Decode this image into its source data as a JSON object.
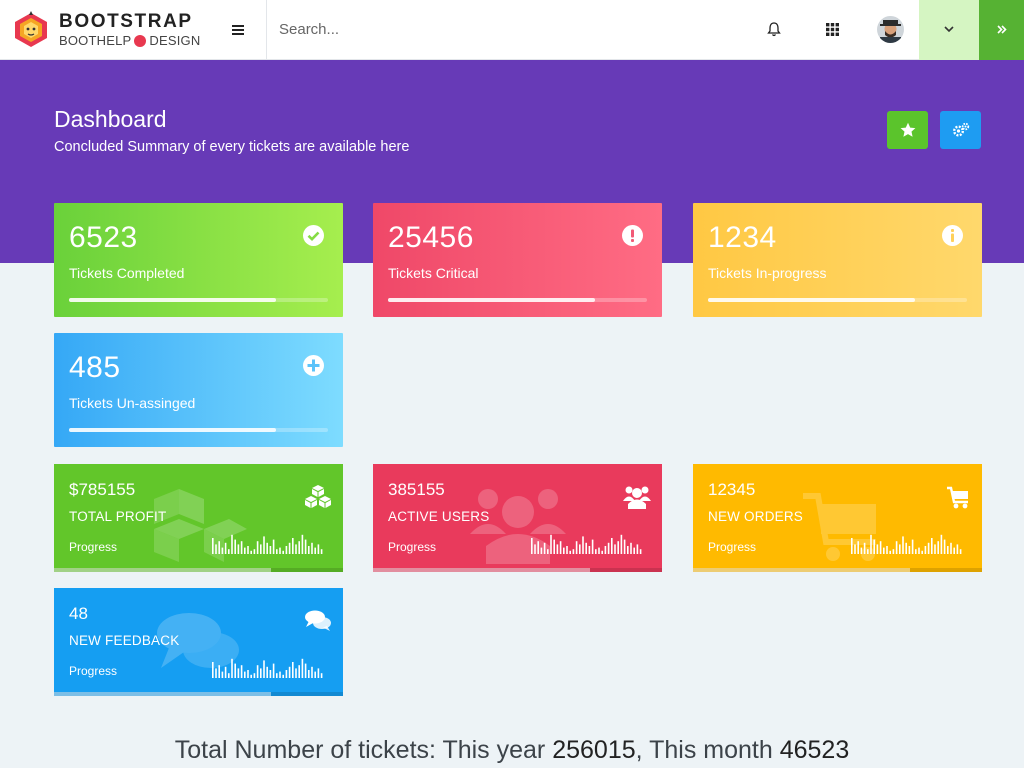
{
  "brand": {
    "title": "BOOTSTRAP",
    "sub_left": "BOOTHELP",
    "sub_right": "DESIGN"
  },
  "topbar": {
    "search_placeholder": "Search..."
  },
  "header": {
    "title": "Dashboard",
    "subtitle": "Concluded Summary of every tickets are available here"
  },
  "stats": [
    {
      "value": "6523",
      "label": "Tickets Completed",
      "progress": 0.8,
      "icon": "check-circle-icon"
    },
    {
      "value": "25456",
      "label": "Tickets Critical",
      "progress": 0.8,
      "icon": "exclamation-circle-icon"
    },
    {
      "value": "1234",
      "label": "Tickets In-progress",
      "progress": 0.8,
      "icon": "info-circle-icon"
    },
    {
      "value": "485",
      "label": "Tickets Un-assinged",
      "progress": 0.8,
      "icon": "plus-circle-icon"
    }
  ],
  "info_cards": [
    {
      "value": "$785155",
      "title": "TOTAL PROFIT",
      "progress_label": "Progress",
      "progress": 0.75,
      "icon": "cubes-icon"
    },
    {
      "value": "385155",
      "title": "ACTIVE USERS",
      "progress_label": "Progress",
      "progress": 0.75,
      "icon": "users-icon"
    },
    {
      "value": "12345",
      "title": "NEW ORDERS",
      "progress_label": "Progress",
      "progress": 0.75,
      "icon": "cart-icon"
    },
    {
      "value": "48",
      "title": "NEW FEEDBACK",
      "progress_label": "Progress",
      "progress": 0.75,
      "icon": "comments-icon"
    }
  ],
  "summary": {
    "prefix": "Total Number of tickets: This year",
    "year_value": "256015",
    "mid": ", This month",
    "month_value": "46523"
  },
  "colors": {
    "header_band": "#673ab7",
    "green": "#62c62a",
    "red": "#e93a5c",
    "yellow": "#ffba00",
    "blue": "#159ef2"
  }
}
